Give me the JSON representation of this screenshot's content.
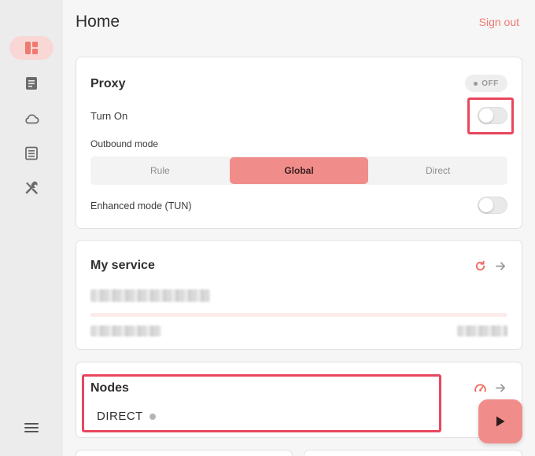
{
  "window": {
    "title": "Home"
  },
  "header": {
    "title": "Home",
    "sign_out_label": "Sign out"
  },
  "sidebar": {
    "items": [
      {
        "name": "dashboard",
        "icon": "dashboard-icon",
        "active": true
      },
      {
        "name": "profiles",
        "icon": "document-icon",
        "active": false
      },
      {
        "name": "cloud",
        "icon": "cloud-icon",
        "active": false
      },
      {
        "name": "logs",
        "icon": "list-icon",
        "active": false
      },
      {
        "name": "tools",
        "icon": "tools-icon",
        "active": false
      }
    ],
    "menu_icon": "hamburger-icon"
  },
  "proxy": {
    "title": "Proxy",
    "status_badge": "OFF",
    "turn_on_label": "Turn On",
    "turn_on_enabled": false,
    "outbound_mode_label": "Outbound mode",
    "modes": [
      "Rule",
      "Global",
      "Direct"
    ],
    "selected_mode": "Global",
    "enhanced_mode_label": "Enhanced mode (TUN)",
    "enhanced_mode_enabled": false
  },
  "service": {
    "title": "My service",
    "refresh_icon": "refresh-icon",
    "arrow_icon": "arrow-right-icon",
    "usage_fraction": 0.0
  },
  "nodes": {
    "title": "Nodes",
    "current_node": "DIRECT",
    "speed_icon": "speedometer-icon",
    "arrow_icon": "arrow-right-icon"
  },
  "fab": {
    "icon": "play-icon"
  },
  "colors": {
    "accent": "#f08d8a",
    "accent_text": "#ee7a72",
    "highlight": "#e8475e",
    "sidebar_active": "#f9d7d5"
  }
}
